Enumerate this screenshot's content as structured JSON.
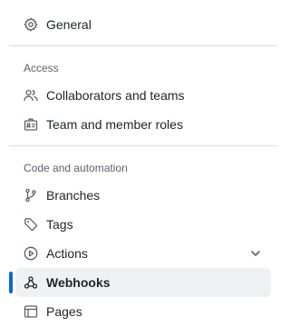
{
  "nav": {
    "general": {
      "label": "General",
      "icon": "gear-icon"
    },
    "sections": [
      {
        "heading": "Access",
        "items": [
          {
            "label": "Collaborators and teams",
            "icon": "people-icon"
          },
          {
            "label": "Team and member roles",
            "icon": "id-badge-icon"
          }
        ]
      },
      {
        "heading": "Code and automation",
        "items": [
          {
            "label": "Branches",
            "icon": "git-branch-icon"
          },
          {
            "label": "Tags",
            "icon": "tag-icon"
          },
          {
            "label": "Actions",
            "icon": "play-icon",
            "expandable": true
          },
          {
            "label": "Webhooks",
            "icon": "webhook-icon",
            "active": true
          },
          {
            "label": "Pages",
            "icon": "browser-icon"
          }
        ]
      }
    ]
  },
  "colors": {
    "accent": "#0969da",
    "active_bg": "#eef0f2",
    "text": "#1f2328",
    "muted": "#59636e",
    "divider": "#d8dee4"
  }
}
